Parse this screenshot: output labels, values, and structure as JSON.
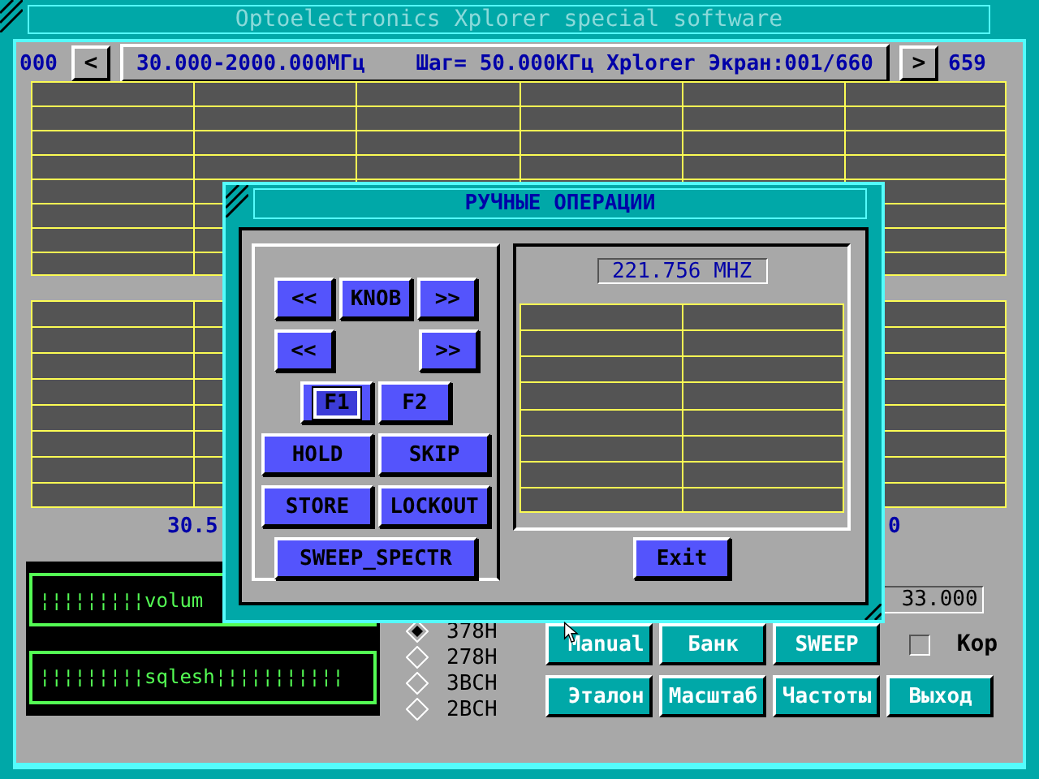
{
  "window": {
    "title": "Optoelectronics Xplorer  special software"
  },
  "nav": {
    "start": "000",
    "prev": "<",
    "range": "30.000-2000.000МГц    Шаг= 50.000КГц Xplorer Экран:001/660",
    "next": ">",
    "end": "659"
  },
  "axis_labels": [
    "30.5",
    "0"
  ],
  "meters": [
    {
      "text": "¦¦¦¦¦¦¦¦¦volum"
    },
    {
      "text": "¦¦¦¦¦¦¦¦¦sqlesh¦¦¦¦¦¦¦¦¦¦¦"
    }
  ],
  "value_field": "33.000",
  "radios": [
    {
      "label": "378H",
      "selected": true
    },
    {
      "label": "278H",
      "selected": false
    },
    {
      "label": "3BCH",
      "selected": false
    },
    {
      "label": "2BCH",
      "selected": false
    }
  ],
  "button_rows": [
    [
      {
        "label": "Manual"
      },
      {
        "label": "Банк"
      },
      {
        "label": "SWEEP"
      }
    ],
    [
      {
        "label": "Эталон"
      },
      {
        "label": "Масштаб"
      },
      {
        "label": "Частоты"
      },
      {
        "label": "Выход"
      }
    ]
  ],
  "checkbox": {
    "label": "Кор",
    "checked": false
  },
  "dialog": {
    "title": "РУЧНЫЕ ОПЕРАЦИИ",
    "button_rows": [
      [
        {
          "label": "<<",
          "focused": false
        },
        {
          "label": "KNOB",
          "focused": false
        },
        {
          "label": ">>",
          "focused": false
        }
      ],
      [
        {
          "label": "<<",
          "focused": false
        },
        {
          "label": ">>",
          "focused": false
        }
      ],
      [
        {
          "label": "F1",
          "focused": true
        },
        {
          "label": "F2",
          "focused": false
        }
      ],
      [
        {
          "label": "HOLD",
          "focused": false
        },
        {
          "label": "SKIP",
          "focused": false
        }
      ],
      [
        {
          "label": "STORE",
          "focused": false
        },
        {
          "label": "LOCKOUT",
          "focused": false
        }
      ],
      [
        {
          "label": "SWEEP_SPECTR",
          "focused": false
        }
      ]
    ],
    "frequency": "221.756 MHZ",
    "exit": "Exit"
  }
}
